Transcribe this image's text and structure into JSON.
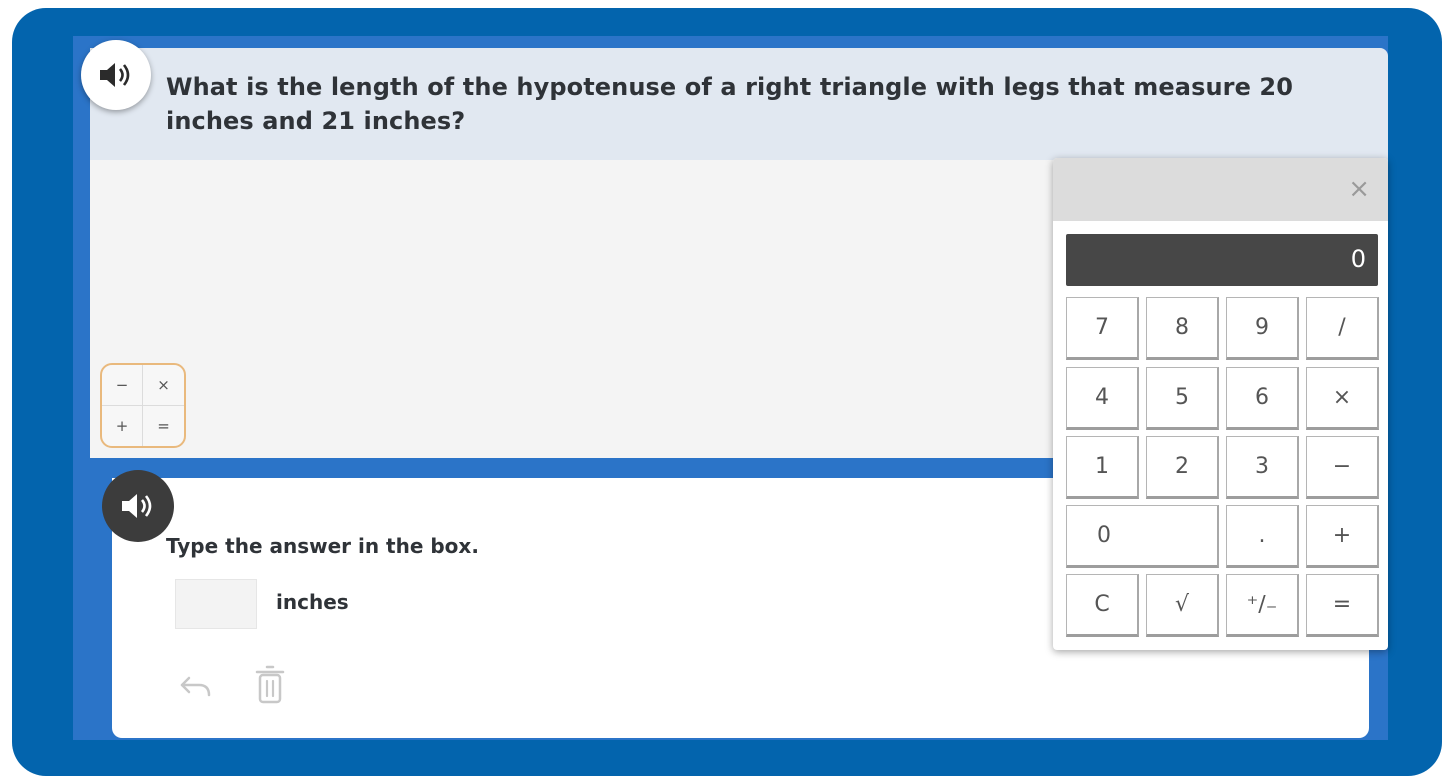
{
  "question": {
    "text": "What is the length of the hypotenuse of a right triangle with legs that measure 20 inches and 21 inches?"
  },
  "operations_widget": {
    "symbols": [
      "−",
      "×",
      "+",
      "="
    ]
  },
  "answer": {
    "instruction": "Type the answer in the box.",
    "input_value": "",
    "unit": "inches"
  },
  "calculator": {
    "close_label": "×",
    "display": "0",
    "keys": {
      "k7": "7",
      "k8": "8",
      "k9": "9",
      "kdiv": "/",
      "k4": "4",
      "k5": "5",
      "k6": "6",
      "kmul": "×",
      "k1": "1",
      "k2": "2",
      "k3": "3",
      "ksub": "−",
      "k0": "0",
      "kdot": ".",
      "kadd": "+",
      "kclear": "C",
      "ksqrt": "√",
      "ksign": "⁺∕₋",
      "keq": "="
    }
  },
  "colors": {
    "frame": "#0364ad",
    "stage": "#2b74c8",
    "question_bg": "#e1e8f1",
    "ops_border": "#e9b97d",
    "display_bg": "#474747"
  }
}
